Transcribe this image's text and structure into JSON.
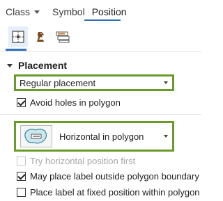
{
  "tabs": {
    "class_label": "Class",
    "symbol_label": "Symbol",
    "position_label": "Position"
  },
  "subtools": {
    "icons": [
      "position-grid-icon",
      "conflict-resolution-chess-icon",
      "fitting-strategy-icon"
    ]
  },
  "placement": {
    "section_title": "Placement",
    "placement_select": {
      "value": "Regular placement"
    },
    "avoid_holes": {
      "label": "Avoid holes in polygon",
      "checked": true
    },
    "position_select": {
      "value": "Horizontal in polygon",
      "icon": "horizontal-in-polygon-icon"
    },
    "try_horizontal": {
      "label": "Try horizontal position first",
      "checked": false,
      "disabled": true
    },
    "may_place_outside": {
      "label": "May place label outside polygon boundary",
      "checked": true
    },
    "fixed_position": {
      "label": "Place label at fixed position within polygon",
      "checked": false
    }
  },
  "colors": {
    "accent": "#2f6fb5",
    "highlight_border": "#6a9a2c",
    "polygon_fill": "#cfe6ee",
    "polygon_stroke": "#2a8aa0"
  }
}
